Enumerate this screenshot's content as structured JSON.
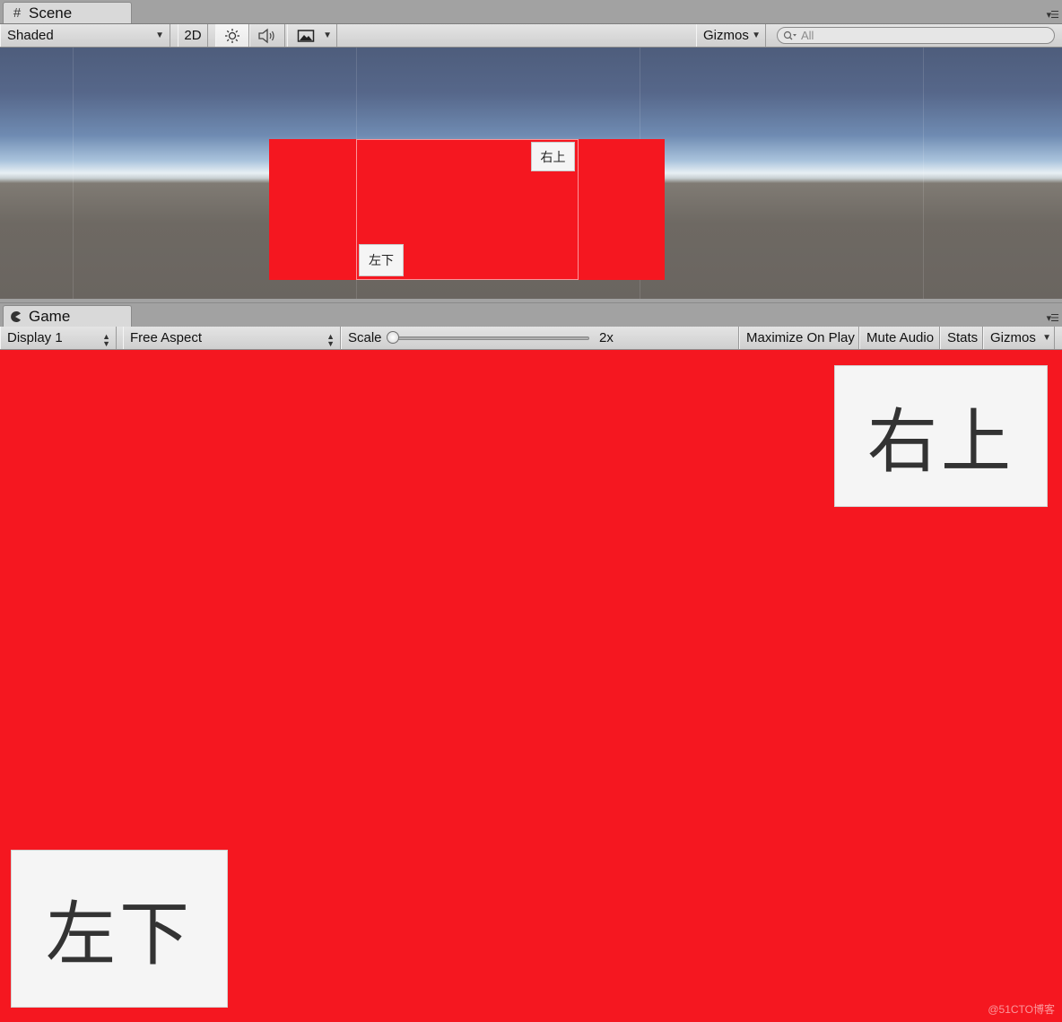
{
  "scene": {
    "tab_label": "Scene",
    "shading_mode": "Shaded",
    "mode_2d_label": "2D",
    "gizmos_label": "Gizmos",
    "search_placeholder": "All",
    "buttons": {
      "top_right": "右上",
      "bottom_left": "左下"
    }
  },
  "game": {
    "tab_label": "Game",
    "display": "Display 1",
    "aspect": "Free Aspect",
    "scale_label": "Scale",
    "scale_value": "2x",
    "scale_fraction": 0.0,
    "maximize_label": "Maximize On Play",
    "mute_label": "Mute Audio",
    "stats_label": "Stats",
    "gizmos_label": "Gizmos",
    "buttons": {
      "top_right": "右上",
      "bottom_left": "左下"
    }
  },
  "watermark": "@51CTO博客",
  "colors": {
    "canvas_red": "#f51720",
    "button_bg": "#f5f5f5"
  },
  "icons": [
    "grid-icon",
    "sun-icon",
    "speaker-icon",
    "image-icon",
    "search-icon",
    "pacman-icon",
    "panel-menu-icon"
  ]
}
